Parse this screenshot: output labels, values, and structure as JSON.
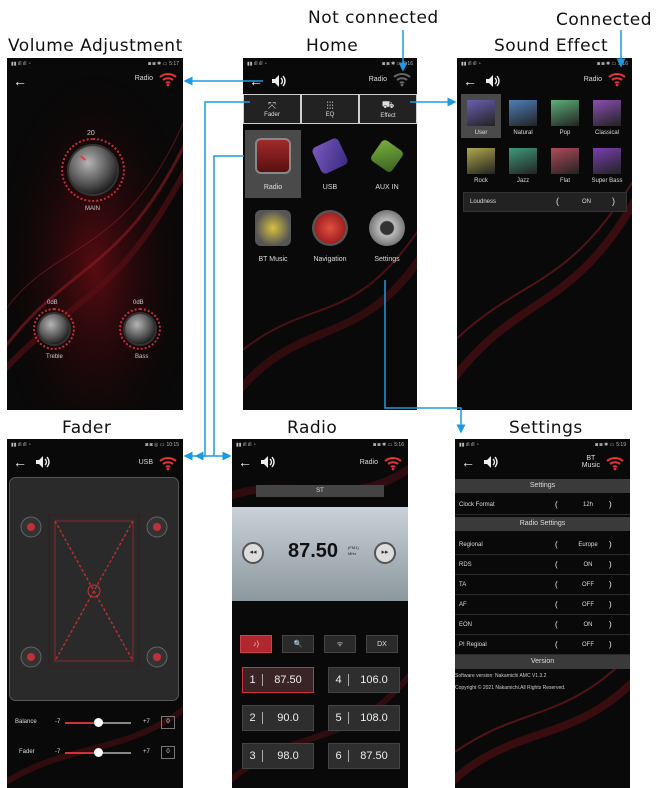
{
  "captions": {
    "volume": "Volume Adjustment",
    "home": "Home",
    "sound_effect": "Sound Effect",
    "not_connected": "Not connected",
    "connected": "Connected",
    "fader": "Fader",
    "radio": "Radio",
    "settings": "Settings"
  },
  "volume_screen": {
    "source": "Radio",
    "main_value": "20",
    "main_label": "MAIN",
    "treble_value": "0dB",
    "treble_label": "Treble",
    "bass_value": "0dB",
    "bass_label": "Bass"
  },
  "home_screen": {
    "source": "Radio",
    "tabs": [
      "Fader",
      "EQ",
      "Effect"
    ],
    "apps": [
      "Radio",
      "USB",
      "AUX IN",
      "BT Music",
      "Navigation",
      "Settings"
    ]
  },
  "sound_effect_screen": {
    "source": "Radio",
    "presets": [
      "User",
      "Natural",
      "Pop",
      "Classical",
      "Rock",
      "Jazz",
      "Flat",
      "Super Bass"
    ],
    "preset_colors": [
      "#6a5fb0",
      "#4d7fb8",
      "#5bb07a",
      "#8a4fb0",
      "#b0a84a",
      "#3f9a7a",
      "#b04a5a",
      "#7a3fb0"
    ],
    "loudness_label": "Loudness",
    "loudness_value": "ON"
  },
  "fader_screen": {
    "source": "USB",
    "balance_label": "Balance",
    "fader_label": "Fader",
    "min": "-7",
    "max": "+7",
    "balance_value": "0",
    "fader_value": "0"
  },
  "radio_screen": {
    "source": "Radio",
    "st": "ST",
    "frequency": "87.50",
    "unit_top": "(FM1)",
    "unit_bottom": "MHz",
    "dx": "DX",
    "presets": [
      {
        "n": "1",
        "f": "87.50"
      },
      {
        "n": "4",
        "f": "106.0"
      },
      {
        "n": "2",
        "f": "90.0"
      },
      {
        "n": "5",
        "f": "108.0"
      },
      {
        "n": "3",
        "f": "98.0"
      },
      {
        "n": "6",
        "f": "87.50"
      }
    ]
  },
  "settings_screen": {
    "source": "BT\nMusic",
    "section_settings": "Settings",
    "clock_label": "Clock Format",
    "clock_value": "12h",
    "section_radio": "Radio Settings",
    "rows": [
      {
        "label": "Regional",
        "value": "Europe"
      },
      {
        "label": "RDS",
        "value": "ON"
      },
      {
        "label": "TA",
        "value": "OFF"
      },
      {
        "label": "AF",
        "value": "OFF"
      },
      {
        "label": "EON",
        "value": "ON"
      },
      {
        "label": "PI Regioal",
        "value": "OFF"
      }
    ],
    "section_version": "Version",
    "software_version": "Software version: Nakamichi AMC V1.3.2",
    "copyright": "Copyright © 2021 Nakamichi.All Rights Reserved."
  },
  "status": {
    "time_a": "5:17",
    "time_b": "5:16",
    "time_c": "10:15",
    "time_d": "5:19"
  },
  "colors": {
    "accent_red": "#d0323a",
    "connector_blue": "#1e9be0",
    "bg": "#090909"
  }
}
